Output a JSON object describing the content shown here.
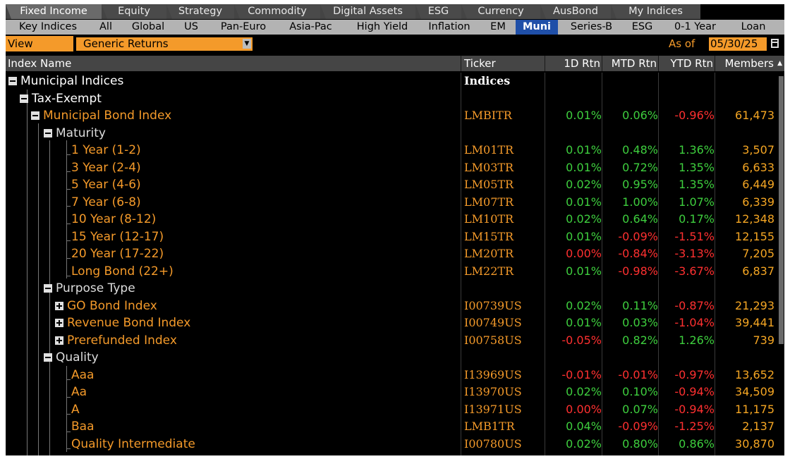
{
  "tabs": [
    {
      "label": "Fixed Income",
      "active": true
    },
    {
      "label": "Equity"
    },
    {
      "label": "Strategy"
    },
    {
      "label": "Commodity"
    },
    {
      "label": "Digital Assets"
    },
    {
      "label": "ESG"
    },
    {
      "label": "Currency"
    },
    {
      "label": "AusBond"
    },
    {
      "label": "My Indices"
    }
  ],
  "subtabs": [
    {
      "label": "Key Indices"
    },
    {
      "label": "All"
    },
    {
      "label": "Global"
    },
    {
      "label": "US"
    },
    {
      "label": "Pan-Euro"
    },
    {
      "label": "Asia-Pac"
    },
    {
      "label": "High Yield"
    },
    {
      "label": "Inflation"
    },
    {
      "label": "EM"
    },
    {
      "label": "Muni",
      "active": true
    },
    {
      "label": "Series-B"
    },
    {
      "label": "ESG"
    },
    {
      "label": "0-1 Year"
    },
    {
      "label": "Loan"
    }
  ],
  "view": {
    "label": "View",
    "value": "Generic Returns"
  },
  "asof": {
    "label": "As of",
    "value": "05/30/25"
  },
  "columns": {
    "name": "Index Name",
    "ticker": "Ticker",
    "d1": "1D Rtn",
    "mtd": "MTD Rtn",
    "ytd": "YTD Rtn",
    "members": "Members"
  },
  "rows": [
    {
      "name": "Municipal Indices",
      "ticker": "Indices",
      "d1": "",
      "mtd": "",
      "ytd": "",
      "members": ""
    },
    {
      "name": "Tax-Exempt",
      "ticker": "",
      "d1": "",
      "mtd": "",
      "ytd": "",
      "members": ""
    },
    {
      "name": "Municipal Bond Index",
      "ticker": "LMBITR",
      "d1": "0.01%",
      "mtd": "0.06%",
      "ytd": "-0.96%",
      "members": "61,473"
    },
    {
      "name": "Maturity",
      "ticker": "",
      "d1": "",
      "mtd": "",
      "ytd": "",
      "members": ""
    },
    {
      "name": "1 Year (1-2)",
      "ticker": "LM01TR",
      "d1": "0.01%",
      "mtd": "0.48%",
      "ytd": "1.36%",
      "members": "3,507"
    },
    {
      "name": "3 Year (2-4)",
      "ticker": "LM03TR",
      "d1": "0.01%",
      "mtd": "0.72%",
      "ytd": "1.35%",
      "members": "6,633"
    },
    {
      "name": "5 Year (4-6)",
      "ticker": "LM05TR",
      "d1": "0.02%",
      "mtd": "0.95%",
      "ytd": "1.35%",
      "members": "6,449"
    },
    {
      "name": "7 Year (6-8)",
      "ticker": "LM07TR",
      "d1": "0.01%",
      "mtd": "1.00%",
      "ytd": "1.07%",
      "members": "6,339"
    },
    {
      "name": "10 Year (8-12)",
      "ticker": "LM10TR",
      "d1": "0.02%",
      "mtd": "0.64%",
      "ytd": "0.17%",
      "members": "12,348"
    },
    {
      "name": "15 Year (12-17)",
      "ticker": "LM15TR",
      "d1": "0.01%",
      "mtd": "-0.09%",
      "ytd": "-1.51%",
      "members": "12,155"
    },
    {
      "name": "20 Year (17-22)",
      "ticker": "LM20TR",
      "d1": "0.00%",
      "mtd": "-0.84%",
      "ytd": "-3.13%",
      "members": "7,205"
    },
    {
      "name": "Long Bond (22+)",
      "ticker": "LM22TR",
      "d1": "0.01%",
      "mtd": "-0.98%",
      "ytd": "-3.67%",
      "members": "6,837"
    },
    {
      "name": "Purpose Type",
      "ticker": "",
      "d1": "",
      "mtd": "",
      "ytd": "",
      "members": ""
    },
    {
      "name": "GO Bond Index",
      "ticker": "I00739US",
      "d1": "0.02%",
      "mtd": "0.11%",
      "ytd": "-0.87%",
      "members": "21,293"
    },
    {
      "name": "Revenue Bond Index",
      "ticker": "I00749US",
      "d1": "0.01%",
      "mtd": "0.03%",
      "ytd": "-1.04%",
      "members": "39,441"
    },
    {
      "name": "Prerefunded Index",
      "ticker": "I00758US",
      "d1": "-0.05%",
      "mtd": "0.82%",
      "ytd": "1.26%",
      "members": "739"
    },
    {
      "name": "Quality",
      "ticker": "",
      "d1": "",
      "mtd": "",
      "ytd": "",
      "members": ""
    },
    {
      "name": "Aaa",
      "ticker": "I13969US",
      "d1": "-0.01%",
      "mtd": "-0.01%",
      "ytd": "-0.97%",
      "members": "13,652"
    },
    {
      "name": "Aa",
      "ticker": "I13970US",
      "d1": "0.02%",
      "mtd": "0.10%",
      "ytd": "-0.94%",
      "members": "34,509"
    },
    {
      "name": "A",
      "ticker": "I13971US",
      "d1": "0.00%",
      "mtd": "0.07%",
      "ytd": "-0.94%",
      "members": "11,175"
    },
    {
      "name": "Baa",
      "ticker": "LMB1TR",
      "d1": "0.04%",
      "mtd": "-0.09%",
      "ytd": "-1.25%",
      "members": "2,137"
    },
    {
      "name": "Quality Intermediate",
      "ticker": "I00780US",
      "d1": "0.02%",
      "mtd": "0.80%",
      "ytd": "0.86%",
      "members": "30,870"
    }
  ],
  "colors": {
    "positive": "#3ecf3e",
    "negative": "#ff3030",
    "orange": "#f49a2a",
    "active_subtab": "#1f4fa8"
  }
}
